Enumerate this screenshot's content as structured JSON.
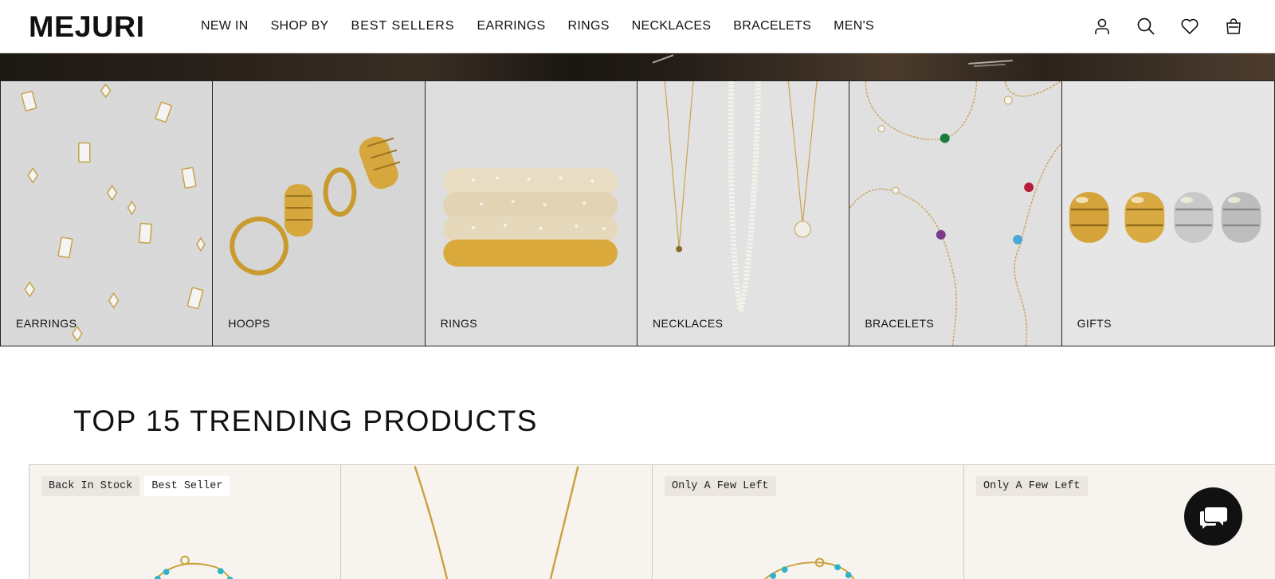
{
  "header": {
    "logo": "MEJURI",
    "nav": [
      "NEW IN",
      "SHOP BY",
      "BEST SELLERS",
      "EARRINGS",
      "RINGS",
      "NECKLACES",
      "BRACELETS",
      "MEN'S"
    ],
    "icons": [
      "account-icon",
      "search-icon",
      "heart-icon",
      "bag-icon"
    ]
  },
  "categories": [
    {
      "label": "EARRINGS",
      "icon": "earrings-image"
    },
    {
      "label": "HOOPS",
      "icon": "hoops-image"
    },
    {
      "label": "RINGS",
      "icon": "rings-image"
    },
    {
      "label": "NECKLACES",
      "icon": "necklaces-image"
    },
    {
      "label": "BRACELETS",
      "icon": "bracelets-image"
    },
    {
      "label": "GIFTS",
      "icon": "gifts-image"
    }
  ],
  "section": {
    "title": "TOP 15 TRENDING PRODUCTS"
  },
  "products": [
    {
      "badges": [
        "Back In Stock",
        "Best Seller"
      ]
    },
    {
      "badges": []
    },
    {
      "badges": [
        "Only A Few Left"
      ]
    },
    {
      "badges": [
        "Only A Few Left"
      ]
    }
  ],
  "chat": {
    "icon": "chat-icon"
  },
  "colors": {
    "text": "#111111",
    "product_bg": "#f7f4ef",
    "badge_bg": "#ebe6df",
    "gold": "#c9a13b",
    "turquoise": "#2fb3c6"
  }
}
